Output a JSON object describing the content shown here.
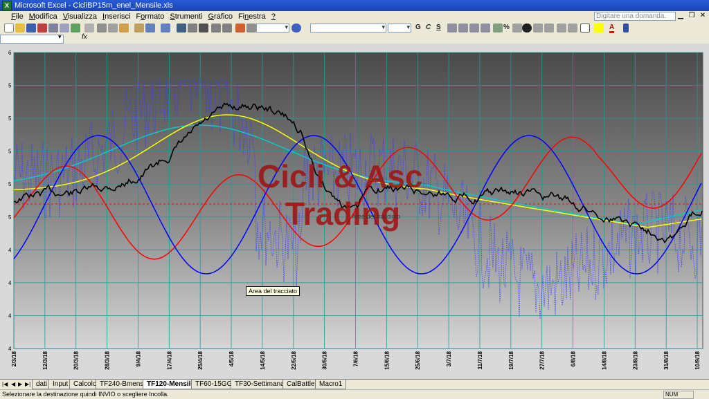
{
  "window": {
    "title": "Microsoft Excel - CicliBP15m_enel_Mensile.xls",
    "app_icon": "X"
  },
  "menu": [
    {
      "label": "File",
      "key": "F"
    },
    {
      "label": "Modifica",
      "key": "M"
    },
    {
      "label": "Visualizza",
      "key": "V"
    },
    {
      "label": "Inserisci",
      "key": "I"
    },
    {
      "label": "Formato",
      "key": "o"
    },
    {
      "label": "Strumenti",
      "key": "S"
    },
    {
      "label": "Grafico",
      "key": "G"
    },
    {
      "label": "Finestra",
      "key": "n"
    },
    {
      "label": "?",
      "key": "?"
    }
  ],
  "help": {
    "placeholder": "Digitare una domanda."
  },
  "formula": {
    "fx": "fx"
  },
  "chart": {
    "watermark_line1": "Cicli & Asc",
    "watermark_line2": "Trading",
    "tooltip": "Area del tracciato",
    "faint_label": "Area del tracciato",
    "y_tick_labels": [
      "6",
      "5",
      "5",
      "5",
      "5",
      "5",
      "4",
      "4",
      "4",
      "4"
    ],
    "x_tick_labels": [
      "2/3/18",
      "12/3/18",
      "20/3/18",
      "28/3/18",
      "9/4/18",
      "17/4/18",
      "25/4/18",
      "4/5/18",
      "14/5/18",
      "22/5/18",
      "30/5/18",
      "7/6/18",
      "15/6/18",
      "25/6/18",
      "3/7/18",
      "11/7/18",
      "19/7/18",
      "27/7/18",
      "6/8/18",
      "14/8/18",
      "23/8/18",
      "31/8/18",
      "10/9/18"
    ],
    "colors": {
      "price": "#000000",
      "red": "#ff0000",
      "blue": "#0000ff",
      "yellow": "#ffff00",
      "cyan": "#00cccc",
      "dotted": "#3a3aff",
      "watermark": "#a01010"
    }
  },
  "sheet_tabs": [
    "dati",
    "Input",
    "Calcolo",
    "TF240-Bmensile",
    "TF120-Mensile",
    "TF60-15GG",
    "TF30-Settimanale",
    "CalBattle",
    "Macro1"
  ],
  "active_tab": "TF120-Mensile",
  "status": {
    "message": "Selezionare la destinazione quindi INVIO o scegliere Incolla.",
    "num": "NUM"
  }
}
